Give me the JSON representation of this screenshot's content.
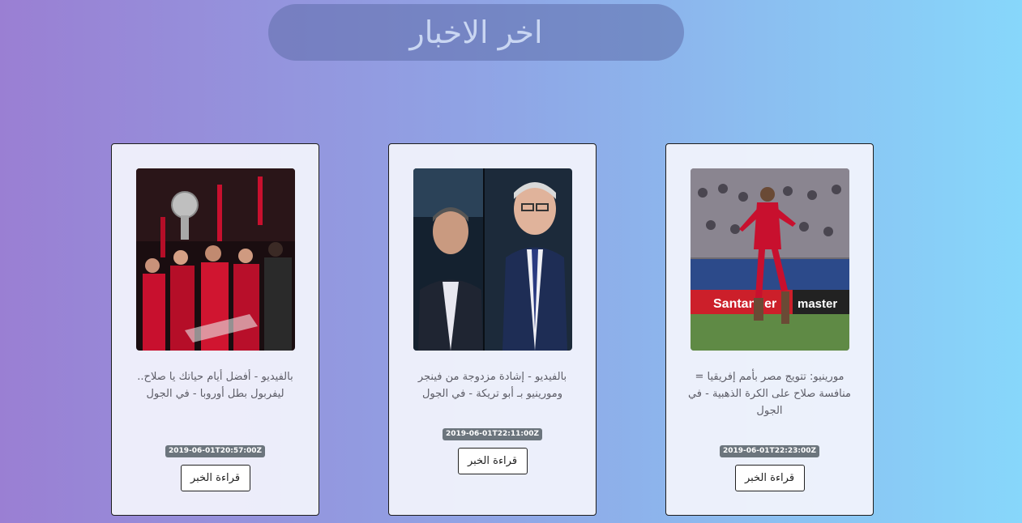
{
  "page": {
    "title": "اخر الاخبار"
  },
  "articles": [
    {
      "headline": "بالفيديو - أفضل أيام حياتك يا صلاح.. ليفربول بطل أوروبا - في الجول",
      "date": "2019-06-01T20:57:00Z",
      "button_label": "قراءة الخبر"
    },
    {
      "headline": "بالفيديو - إشادة مزدوجة من فينجر ومورينيو بـ أبو تريكة - في الجول",
      "date": "2019-06-01T22:11:00Z",
      "button_label": "قراءة الخبر"
    },
    {
      "headline": "مورينيو: تتويج مصر بأمم إفريقيا = منافسة صلاح على الكرة الذهبية - في الجول",
      "date": "2019-06-01T22:23:00Z",
      "button_label": "قراءة الخبر"
    }
  ],
  "photo_signage": {
    "ad_board_text": "Santander",
    "ad_board_text_2": "master"
  },
  "colors": {
    "bg_start": "#9a7fd3",
    "bg_end": "#87d7fb",
    "date_badge": "#6c757d",
    "liverpool_red": "#c8102e"
  }
}
